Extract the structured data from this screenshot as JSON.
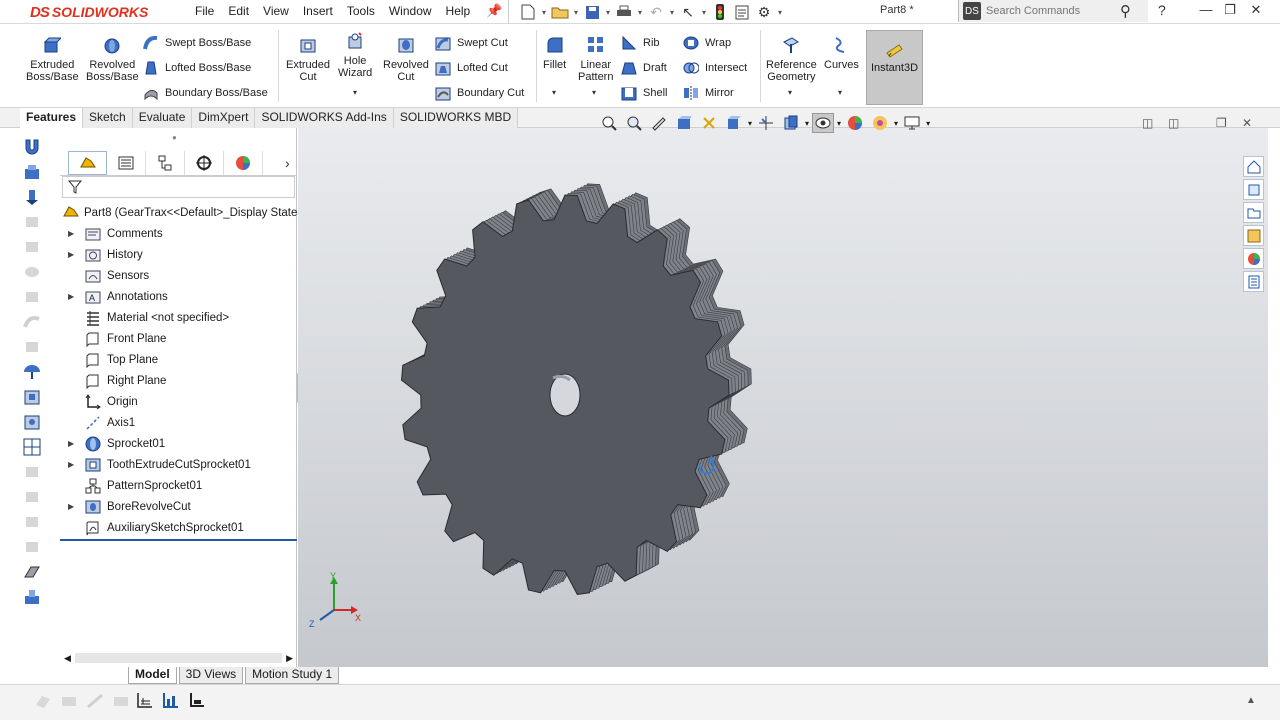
{
  "app": {
    "logo_ds": "DS",
    "logo_text": "SOLIDWORKS",
    "doc_title": "Part8 *"
  },
  "menu": [
    "File",
    "Edit",
    "View",
    "Insert",
    "Tools",
    "Window",
    "Help"
  ],
  "search": {
    "placeholder": "Search Commands"
  },
  "ribbon": {
    "extruded_boss": "Extruded\nBoss/Base",
    "revolved_boss": "Revolved\nBoss/Base",
    "swept_boss": "Swept Boss/Base",
    "lofted_boss": "Lofted Boss/Base",
    "boundary_boss": "Boundary Boss/Base",
    "extruded_cut": "Extruded\nCut",
    "hole_wizard": "Hole\nWizard",
    "revolved_cut": "Revolved\nCut",
    "swept_cut": "Swept Cut",
    "lofted_cut": "Lofted Cut",
    "boundary_cut": "Boundary Cut",
    "fillet": "Fillet",
    "linear_pattern": "Linear\nPattern",
    "rib": "Rib",
    "draft": "Draft",
    "shell": "Shell",
    "wrap": "Wrap",
    "intersect": "Intersect",
    "mirror": "Mirror",
    "reference_geometry": "Reference\nGeometry",
    "curves": "Curves",
    "instant3d": "Instant3D"
  },
  "command_tabs": [
    "Features",
    "Sketch",
    "Evaluate",
    "DimXpert",
    "SOLIDWORKS Add-Ins",
    "SOLIDWORKS MBD"
  ],
  "feature_tree": {
    "root": "Part8  (GearTrax<<Default>_Display State",
    "items": [
      {
        "label": "Comments"
      },
      {
        "label": "History"
      },
      {
        "label": "Sensors"
      },
      {
        "label": "Annotations"
      },
      {
        "label": "Material <not specified>"
      },
      {
        "label": "Front Plane"
      },
      {
        "label": "Top Plane"
      },
      {
        "label": "Right Plane"
      },
      {
        "label": "Origin"
      },
      {
        "label": "Axis1"
      },
      {
        "label": "Sprocket01"
      },
      {
        "label": "ToothExtrudeCutSprocket01"
      },
      {
        "label": "PatternSprocket01"
      },
      {
        "label": "BoreRevolveCut"
      },
      {
        "label": "AuxiliarySketchSprocket01"
      }
    ]
  },
  "bottom_tabs": [
    "Model",
    "3D Views",
    "Motion Study 1"
  ],
  "triad": {
    "x": "X",
    "y": "Y",
    "z": "Z"
  },
  "colors": {
    "accent": "#1f5aa8",
    "brand": "#e0311e",
    "part": "#595c64",
    "viewport_top": "#e9ebee"
  }
}
